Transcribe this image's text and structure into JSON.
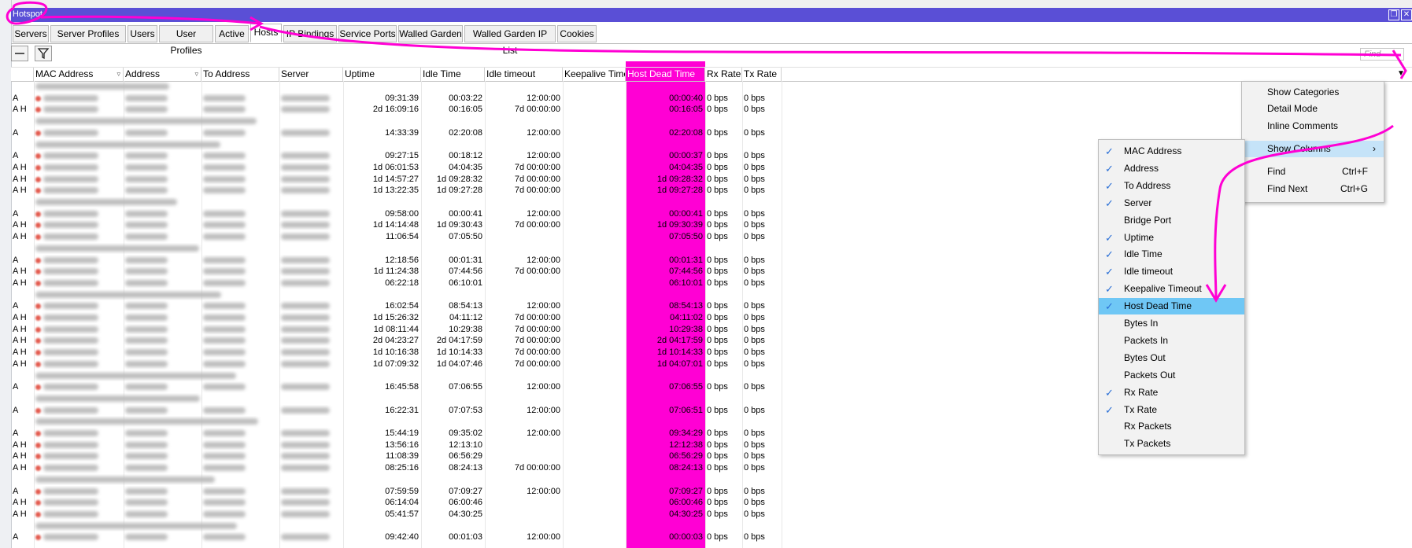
{
  "window": {
    "title": "Hotspot",
    "restore_label": "❐",
    "close_label": "✕"
  },
  "tabs": [
    {
      "label": "Servers",
      "active": false
    },
    {
      "label": "Server Profiles",
      "active": false
    },
    {
      "label": "Users",
      "active": false
    },
    {
      "label": "User Profiles",
      "active": false
    },
    {
      "label": "Active",
      "active": false
    },
    {
      "label": "Hosts",
      "active": true
    },
    {
      "label": "IP Bindings",
      "active": false
    },
    {
      "label": "Service Ports",
      "active": false
    },
    {
      "label": "Walled Garden",
      "active": false
    },
    {
      "label": "Walled Garden IP List",
      "active": false
    },
    {
      "label": "Cookies",
      "active": false
    }
  ],
  "toolbar": {
    "remove_icon": "minus-icon",
    "filter_icon": "filter-icon",
    "find_placeholder": "Find"
  },
  "columns": [
    {
      "label": "MAC Address"
    },
    {
      "label": "Address"
    },
    {
      "label": "To Address"
    },
    {
      "label": "Server"
    },
    {
      "label": "Uptime"
    },
    {
      "label": "Idle Time"
    },
    {
      "label": "Idle timeout"
    },
    {
      "label": "Keepalive Timeout"
    },
    {
      "label": "Host Dead Time"
    },
    {
      "label": "Rx Rate"
    },
    {
      "label": "Tx Rate"
    }
  ],
  "rows": [
    {
      "type": "comment"
    },
    {
      "type": "host",
      "flags": "A",
      "uptime": "09:31:39",
      "idle": "00:03:22",
      "idle_timeout": "12:00:00",
      "dead": "00:00:40",
      "rx": "0 bps",
      "tx": "0 bps"
    },
    {
      "type": "host",
      "flags": "A H",
      "uptime": "2d 16:09:16",
      "idle": "00:16:05",
      "idle_timeout": "7d 00:00:00",
      "dead": "00:16:05",
      "rx": "0 bps",
      "tx": "0 bps"
    },
    {
      "type": "comment"
    },
    {
      "type": "host",
      "flags": "A",
      "uptime": "14:33:39",
      "idle": "02:20:08",
      "idle_timeout": "12:00:00",
      "dead": "02:20:08",
      "rx": "0 bps",
      "tx": "0 bps"
    },
    {
      "type": "comment"
    },
    {
      "type": "host",
      "flags": "A",
      "uptime": "09:27:15",
      "idle": "00:18:12",
      "idle_timeout": "12:00:00",
      "dead": "00:00:37",
      "rx": "0 bps",
      "tx": "0 bps"
    },
    {
      "type": "host",
      "flags": "A H",
      "uptime": "1d 06:01:53",
      "idle": "04:04:35",
      "idle_timeout": "7d 00:00:00",
      "dead": "04:04:35",
      "rx": "0 bps",
      "tx": "0 bps"
    },
    {
      "type": "host",
      "flags": "A H",
      "uptime": "1d 14:57:27",
      "idle": "1d 09:28:32",
      "idle_timeout": "7d 00:00:00",
      "dead": "1d 09:28:32",
      "rx": "0 bps",
      "tx": "0 bps"
    },
    {
      "type": "host",
      "flags": "A H",
      "uptime": "1d 13:22:35",
      "idle": "1d 09:27:28",
      "idle_timeout": "7d 00:00:00",
      "dead": "1d 09:27:28",
      "rx": "0 bps",
      "tx": "0 bps"
    },
    {
      "type": "comment"
    },
    {
      "type": "host",
      "flags": "A",
      "uptime": "09:58:00",
      "idle": "00:00:41",
      "idle_timeout": "12:00:00",
      "dead": "00:00:41",
      "rx": "0 bps",
      "tx": "0 bps"
    },
    {
      "type": "host",
      "flags": "A H",
      "uptime": "1d 14:14:48",
      "idle": "1d 09:30:43",
      "idle_timeout": "7d 00:00:00",
      "dead": "1d 09:30:39",
      "rx": "0 bps",
      "tx": "0 bps"
    },
    {
      "type": "host",
      "flags": "A H",
      "uptime": "11:06:54",
      "idle": "07:05:50",
      "idle_timeout": "",
      "dead": "07:05:50",
      "rx": "0 bps",
      "tx": "0 bps"
    },
    {
      "type": "comment"
    },
    {
      "type": "host",
      "flags": "A",
      "uptime": "12:18:56",
      "idle": "00:01:31",
      "idle_timeout": "12:00:00",
      "dead": "00:01:31",
      "rx": "0 bps",
      "tx": "0 bps"
    },
    {
      "type": "host",
      "flags": "A H",
      "uptime": "1d 11:24:38",
      "idle": "07:44:56",
      "idle_timeout": "7d 00:00:00",
      "dead": "07:44:56",
      "rx": "0 bps",
      "tx": "0 bps"
    },
    {
      "type": "host",
      "flags": "A H",
      "uptime": "06:22:18",
      "idle": "06:10:01",
      "idle_timeout": "",
      "dead": "06:10:01",
      "rx": "0 bps",
      "tx": "0 bps"
    },
    {
      "type": "comment"
    },
    {
      "type": "host",
      "flags": "A",
      "uptime": "16:02:54",
      "idle": "08:54:13",
      "idle_timeout": "12:00:00",
      "dead": "08:54:13",
      "rx": "0 bps",
      "tx": "0 bps"
    },
    {
      "type": "host",
      "flags": "A H",
      "uptime": "1d 15:26:32",
      "idle": "04:11:12",
      "idle_timeout": "7d 00:00:00",
      "dead": "04:11:02",
      "rx": "0 bps",
      "tx": "0 bps"
    },
    {
      "type": "host",
      "flags": "A H",
      "uptime": "1d 08:11:44",
      "idle": "10:29:38",
      "idle_timeout": "7d 00:00:00",
      "dead": "10:29:38",
      "rx": "0 bps",
      "tx": "0 bps"
    },
    {
      "type": "host",
      "flags": "A H",
      "uptime": "2d 04:23:27",
      "idle": "2d 04:17:59",
      "idle_timeout": "7d 00:00:00",
      "dead": "2d 04:17:59",
      "rx": "0 bps",
      "tx": "0 bps"
    },
    {
      "type": "host",
      "flags": "A H",
      "uptime": "1d 10:16:38",
      "idle": "1d 10:14:33",
      "idle_timeout": "7d 00:00:00",
      "dead": "1d 10:14:33",
      "rx": "0 bps",
      "tx": "0 bps"
    },
    {
      "type": "host",
      "flags": "A H",
      "uptime": "1d 07:09:32",
      "idle": "1d 04:07:46",
      "idle_timeout": "7d 00:00:00",
      "dead": "1d 04:07:01",
      "rx": "0 bps",
      "tx": "0 bps"
    },
    {
      "type": "comment"
    },
    {
      "type": "host",
      "flags": "A",
      "uptime": "16:45:58",
      "idle": "07:06:55",
      "idle_timeout": "12:00:00",
      "dead": "07:06:55",
      "rx": "0 bps",
      "tx": "0 bps"
    },
    {
      "type": "comment"
    },
    {
      "type": "host",
      "flags": "A",
      "uptime": "16:22:31",
      "idle": "07:07:53",
      "idle_timeout": "12:00:00",
      "dead": "07:06:51",
      "rx": "0 bps",
      "tx": "0 bps"
    },
    {
      "type": "comment"
    },
    {
      "type": "host",
      "flags": "A",
      "uptime": "15:44:19",
      "idle": "09:35:02",
      "idle_timeout": "12:00:00",
      "dead": "09:34:29",
      "rx": "0 bps",
      "tx": "0 bps"
    },
    {
      "type": "host",
      "flags": "A H",
      "uptime": "13:56:16",
      "idle": "12:13:10",
      "idle_timeout": "",
      "dead": "12:12:38",
      "rx": "0 bps",
      "tx": "0 bps"
    },
    {
      "type": "host",
      "flags": "A H",
      "uptime": "11:08:39",
      "idle": "06:56:29",
      "idle_timeout": "",
      "dead": "06:56:29",
      "rx": "0 bps",
      "tx": "0 bps"
    },
    {
      "type": "host",
      "flags": "A H",
      "uptime": "08:25:16",
      "idle": "08:24:13",
      "idle_timeout": "7d 00:00:00",
      "dead": "08:24:13",
      "rx": "0 bps",
      "tx": "0 bps"
    },
    {
      "type": "comment"
    },
    {
      "type": "host",
      "flags": "A",
      "uptime": "07:59:59",
      "idle": "07:09:27",
      "idle_timeout": "12:00:00",
      "dead": "07:09:27",
      "rx": "0 bps",
      "tx": "0 bps"
    },
    {
      "type": "host",
      "flags": "A H",
      "uptime": "06:14:04",
      "idle": "06:00:46",
      "idle_timeout": "",
      "dead": "06:00:46",
      "rx": "0 bps",
      "tx": "0 bps"
    },
    {
      "type": "host",
      "flags": "A H",
      "uptime": "05:41:57",
      "idle": "04:30:25",
      "idle_timeout": "",
      "dead": "04:30:25",
      "rx": "0 bps",
      "tx": "0 bps"
    },
    {
      "type": "comment"
    },
    {
      "type": "host",
      "flags": "A",
      "uptime": "09:42:40",
      "idle": "00:01:03",
      "idle_timeout": "12:00:00",
      "dead": "00:00:03",
      "rx": "0 bps",
      "tx": "0 bps"
    }
  ],
  "context_menu": {
    "items": [
      {
        "label": "Show Categories",
        "shortcut": ""
      },
      {
        "label": "Detail Mode",
        "shortcut": ""
      },
      {
        "label": "Inline Comments",
        "shortcut": ""
      },
      {
        "label": "Show Columns",
        "shortcut": "",
        "submenu": true
      },
      {
        "label": "Find",
        "shortcut": "Ctrl+F"
      },
      {
        "label": "Find Next",
        "shortcut": "Ctrl+G"
      }
    ],
    "submenu_arrow": "›"
  },
  "columns_menu": {
    "items": [
      {
        "label": "MAC Address",
        "checked": true
      },
      {
        "label": "Address",
        "checked": true
      },
      {
        "label": "To Address",
        "checked": true
      },
      {
        "label": "Server",
        "checked": true
      },
      {
        "label": "Bridge Port",
        "checked": false
      },
      {
        "label": "Uptime",
        "checked": true
      },
      {
        "label": "Idle Time",
        "checked": true
      },
      {
        "label": "Idle timeout",
        "checked": true
      },
      {
        "label": "Keepalive Timeout",
        "checked": true
      },
      {
        "label": "Host Dead Time",
        "checked": true,
        "selected": true
      },
      {
        "label": "Bytes In",
        "checked": false
      },
      {
        "label": "Packets In",
        "checked": false
      },
      {
        "label": "Bytes Out",
        "checked": false
      },
      {
        "label": "Packets Out",
        "checked": false
      },
      {
        "label": "Rx Rate",
        "checked": true
      },
      {
        "label": "Tx Rate",
        "checked": true
      },
      {
        "label": "Rx Packets",
        "checked": false
      },
      {
        "label": "Tx Packets",
        "checked": false
      }
    ]
  },
  "colors": {
    "titlebar": "#5a4fd6",
    "annotation": "#ff00d4",
    "selected_menu": "#6fc7f5"
  }
}
